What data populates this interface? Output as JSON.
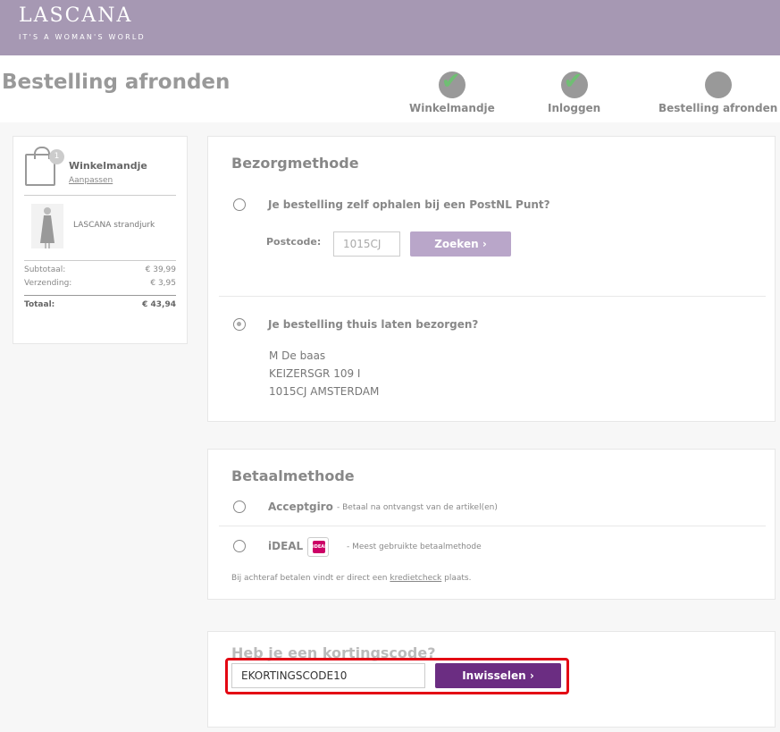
{
  "brand": {
    "name": "LASCANA",
    "tagline": "IT'S A WOMAN'S WORLD"
  },
  "page": {
    "title": "Bestelling afronden",
    "steps": [
      {
        "label": "Winkelmandje",
        "done": true
      },
      {
        "label": "Inloggen",
        "done": true
      },
      {
        "label": "Bestelling afronden",
        "done": false
      }
    ]
  },
  "summary": {
    "title": "Winkelmandje",
    "edit_link": "Aanpassen",
    "item_count": "1",
    "product_name": "LASCANA strandjurk",
    "rows": [
      {
        "label": "Subtotaal:",
        "value": "€ 39,99"
      },
      {
        "label": "Verzending:",
        "value": "€ 3,95"
      }
    ],
    "total_label": "Totaal:",
    "total_value": "€ 43,94"
  },
  "delivery": {
    "title": "Bezorgmethode",
    "pickup_label": "Je bestelling zelf ophalen bij een PostNL Punt?",
    "postcode_label": "Postcode:",
    "postcode_value": "1015CJ",
    "search_button": "Zoeken ›",
    "home_label": "Je bestelling thuis laten bezorgen?",
    "address": [
      "M De baas",
      "KEIZERSGR 109  I",
      "1015CJ AMSTERDAM"
    ]
  },
  "payment": {
    "title": "Betaalmethode",
    "options": [
      {
        "label": "Acceptgiro",
        "note": "- Betaal na ontvangst van de artikel(en)"
      },
      {
        "label": "iDEAL",
        "note": "- Meest gebruikte betaalmethode"
      }
    ],
    "ideal_logo_text": "iDEAL",
    "footer_prefix": "Bij achteraf betalen vindt er direct een",
    "footer_link": "kredietcheck",
    "footer_suffix": "plaats."
  },
  "coupon": {
    "title": "Heb je een kortingscode?",
    "input_value": "EKORTINGSCODE10",
    "redeem_button": "Inwisselen ›"
  },
  "colors": {
    "header": "#a698b3",
    "search_button": "#b9a6c9",
    "redeem_button": "#6b2d82",
    "highlight": "#e30613",
    "check": "#6fbf73"
  }
}
